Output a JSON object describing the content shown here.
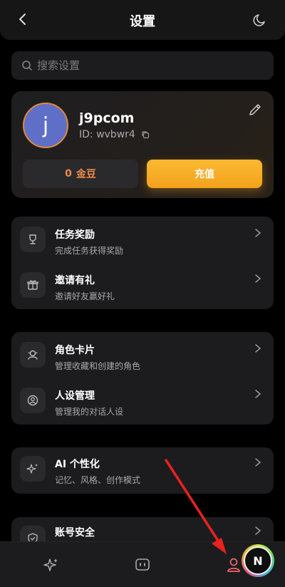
{
  "header": {
    "title": "设置"
  },
  "search": {
    "placeholder": "搜索设置"
  },
  "profile": {
    "avatar_letter": "j",
    "name": "j9pcom",
    "id_text": "ID: wvbwr4",
    "coins_value": "0",
    "coins_unit": "金豆",
    "recharge_label": "充值"
  },
  "groups": [
    {
      "items": [
        {
          "title": "任务奖励",
          "subtitle": "完成任务获得奖励",
          "icon": "trophy-icon"
        },
        {
          "title": "邀请有礼",
          "subtitle": "邀请好友赢好礼",
          "icon": "gift-icon"
        }
      ]
    },
    {
      "items": [
        {
          "title": "角色卡片",
          "subtitle": "管理收藏和创建的角色",
          "icon": "character-icon"
        },
        {
          "title": "人设管理",
          "subtitle": "管理我的对话人设",
          "icon": "persona-icon"
        }
      ]
    },
    {
      "items": [
        {
          "title": "AI 个性化",
          "subtitle": "记忆、风格、创作模式",
          "icon": "sparkle-icon"
        }
      ]
    },
    {
      "items": [
        {
          "title": "账号安全",
          "subtitle": "",
          "icon": "shield-icon"
        }
      ]
    }
  ],
  "tabbar": {
    "tabs": [
      "sparkle-icon",
      "chat-icon",
      "profile-icon"
    ],
    "avatar_letter": "N"
  },
  "colors": {
    "accent": "#f5a623",
    "coin": "#f08a4b",
    "annotation": "#e8221f",
    "active_tab": "#f06a6a"
  }
}
